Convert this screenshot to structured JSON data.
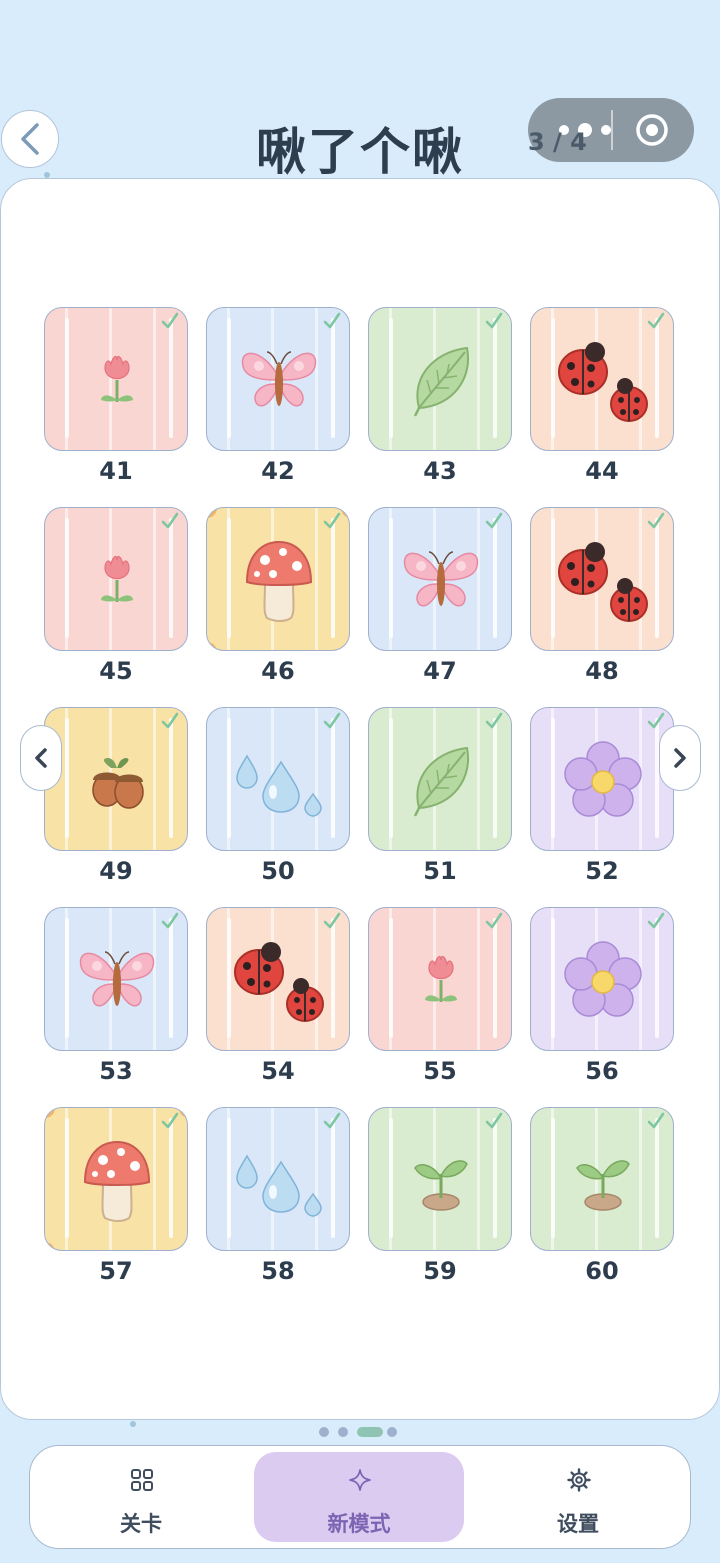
{
  "header": {
    "title": "啾了个啾",
    "page_indicator": "3 / 4"
  },
  "levels": [
    {
      "number": "41",
      "theme": "tulip",
      "bg": "pink",
      "completed": true
    },
    {
      "number": "42",
      "theme": "butterfly",
      "bg": "blue",
      "completed": true
    },
    {
      "number": "43",
      "theme": "leaf",
      "bg": "green",
      "completed": true
    },
    {
      "number": "44",
      "theme": "ladybugs",
      "bg": "peach",
      "completed": true
    },
    {
      "number": "45",
      "theme": "tulip",
      "bg": "pink",
      "completed": true
    },
    {
      "number": "46",
      "theme": "mushroom",
      "bg": "yellow",
      "completed": true
    },
    {
      "number": "47",
      "theme": "butterfly",
      "bg": "blue",
      "completed": true
    },
    {
      "number": "48",
      "theme": "ladybugs",
      "bg": "peach",
      "completed": true
    },
    {
      "number": "49",
      "theme": "acorns",
      "bg": "yellow",
      "completed": true
    },
    {
      "number": "50",
      "theme": "water-drops",
      "bg": "blue",
      "completed": true
    },
    {
      "number": "51",
      "theme": "leaf",
      "bg": "green",
      "completed": true
    },
    {
      "number": "52",
      "theme": "flower",
      "bg": "purple",
      "completed": true
    },
    {
      "number": "53",
      "theme": "butterfly",
      "bg": "blue",
      "completed": true
    },
    {
      "number": "54",
      "theme": "ladybugs",
      "bg": "peach",
      "completed": true
    },
    {
      "number": "55",
      "theme": "tulip",
      "bg": "pink",
      "completed": true
    },
    {
      "number": "56",
      "theme": "flower",
      "bg": "purple",
      "completed": true
    },
    {
      "number": "57",
      "theme": "mushroom",
      "bg": "yellow",
      "completed": true
    },
    {
      "number": "58",
      "theme": "water-drops",
      "bg": "blue",
      "completed": true
    },
    {
      "number": "59",
      "theme": "sprout",
      "bg": "green",
      "completed": true
    },
    {
      "number": "60",
      "theme": "sprout",
      "bg": "green",
      "completed": true
    }
  ],
  "pager": {
    "pages": 4,
    "current": 3
  },
  "tabs": [
    {
      "label": "关卡",
      "icon": "grid-icon",
      "active": false
    },
    {
      "label": "新模式",
      "icon": "sparkle-icon",
      "active": true
    },
    {
      "label": "设置",
      "icon": "gear-icon",
      "active": false
    }
  ],
  "colors": {
    "background": "#d9ecfb",
    "accent_purple": "#dccbf1",
    "check_green": "#7dc7a0",
    "text_dark": "#2c3e50"
  }
}
